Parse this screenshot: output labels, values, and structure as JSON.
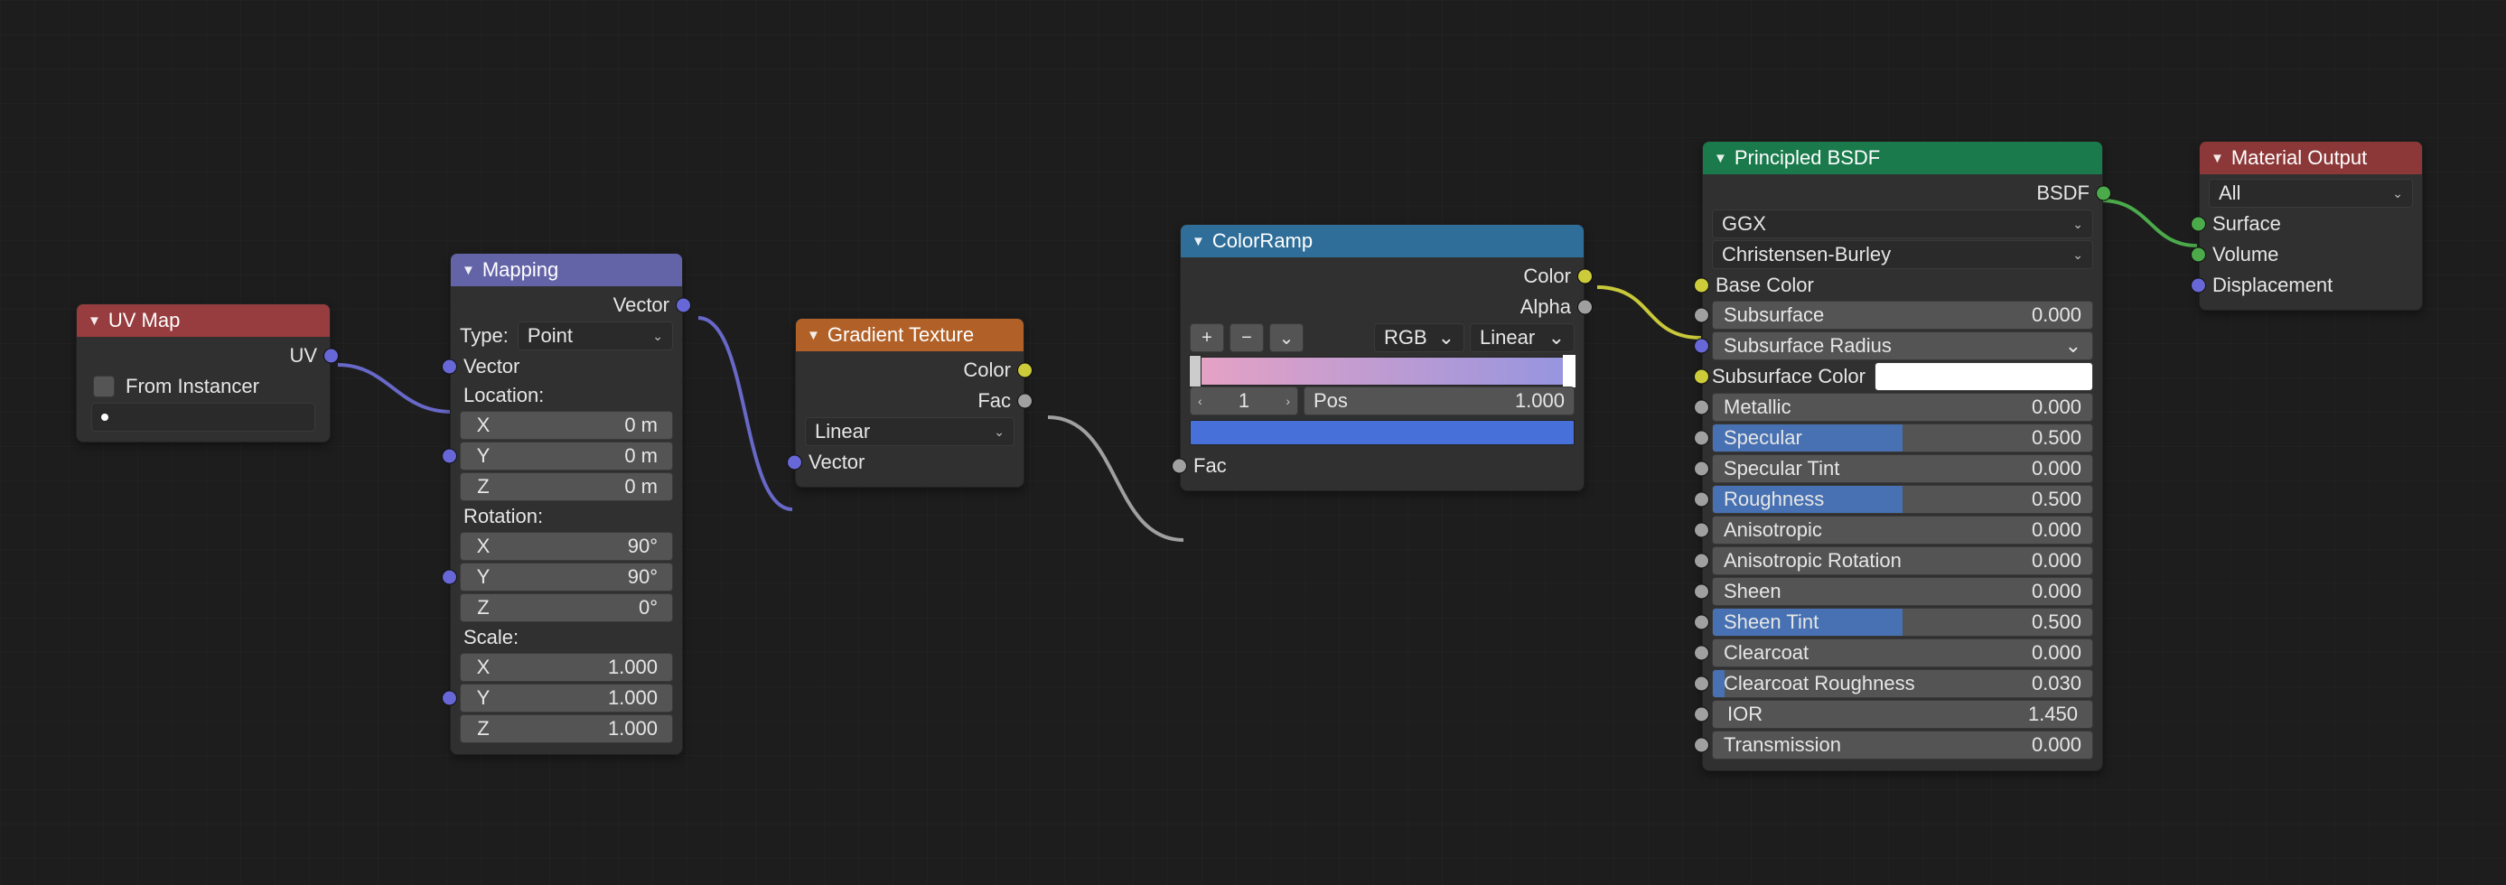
{
  "uvmap": {
    "title": "UV Map",
    "out_uv": "UV",
    "from_instancer": "From Instancer",
    "field_value": ""
  },
  "mapping": {
    "title": "Mapping",
    "out_vector": "Vector",
    "type_label": "Type:",
    "type_value": "Point",
    "vector_label": "Vector",
    "location_label": "Location:",
    "loc": {
      "x_axis": "X",
      "x_val": "0 m",
      "y_axis": "Y",
      "y_val": "0 m",
      "z_axis": "Z",
      "z_val": "0 m"
    },
    "rotation_label": "Rotation:",
    "rot": {
      "x_axis": "X",
      "x_val": "90°",
      "y_axis": "Y",
      "y_val": "90°",
      "z_axis": "Z",
      "z_val": "0°"
    },
    "scale_label": "Scale:",
    "scale": {
      "x_axis": "X",
      "x_val": "1.000",
      "y_axis": "Y",
      "y_val": "1.000",
      "z_axis": "Z",
      "z_val": "1.000"
    }
  },
  "gradient": {
    "title": "Gradient Texture",
    "out_color": "Color",
    "out_fac": "Fac",
    "mode": "Linear",
    "in_vector": "Vector"
  },
  "colorramp": {
    "title": "ColorRamp",
    "out_color": "Color",
    "out_alpha": "Alpha",
    "color_mode": "RGB",
    "interp": "Linear",
    "index_label": "1",
    "pos_label": "Pos",
    "pos_value": "1.000",
    "in_fac": "Fac"
  },
  "bsdf": {
    "title": "Principled BSDF",
    "out_bsdf": "BSDF",
    "distribution": "GGX",
    "subsurf_method": "Christensen-Burley",
    "base_color": "Base Color",
    "props": [
      {
        "name": "Subsurface",
        "val": "0.000",
        "fill": 0,
        "sock": "float"
      },
      {
        "name": "Subsurface Radius",
        "val": "",
        "fill": 0,
        "sock": "vector",
        "dropdown": true
      },
      {
        "name": "Subsurface Color",
        "val": "",
        "fill": 0,
        "sock": "color",
        "swatch": true
      },
      {
        "name": "Metallic",
        "val": "0.000",
        "fill": 0,
        "sock": "float"
      },
      {
        "name": "Specular",
        "val": "0.500",
        "fill": 50,
        "sock": "float"
      },
      {
        "name": "Specular Tint",
        "val": "0.000",
        "fill": 0,
        "sock": "float"
      },
      {
        "name": "Roughness",
        "val": "0.500",
        "fill": 50,
        "sock": "float"
      },
      {
        "name": "Anisotropic",
        "val": "0.000",
        "fill": 0,
        "sock": "float"
      },
      {
        "name": "Anisotropic Rotation",
        "val": "0.000",
        "fill": 0,
        "sock": "float"
      },
      {
        "name": "Sheen",
        "val": "0.000",
        "fill": 0,
        "sock": "float"
      },
      {
        "name": "Sheen Tint",
        "val": "0.500",
        "fill": 50,
        "sock": "float"
      },
      {
        "name": "Clearcoat",
        "val": "0.000",
        "fill": 0,
        "sock": "float"
      },
      {
        "name": "Clearcoat Roughness",
        "val": "0.030",
        "fill": 3,
        "sock": "float"
      },
      {
        "name": "IOR",
        "val": "1.450",
        "fill": 0,
        "sock": "float",
        "noslider": true
      },
      {
        "name": "Transmission",
        "val": "0.000",
        "fill": 0,
        "sock": "float"
      }
    ]
  },
  "output": {
    "title": "Material Output",
    "target": "All",
    "in_surface": "Surface",
    "in_volume": "Volume",
    "in_disp": "Displacement"
  },
  "icons": {
    "tri_down": "▼",
    "chev_down": "⌄",
    "chev_left": "‹",
    "chev_right": "›",
    "plus": "+",
    "minus": "−"
  }
}
